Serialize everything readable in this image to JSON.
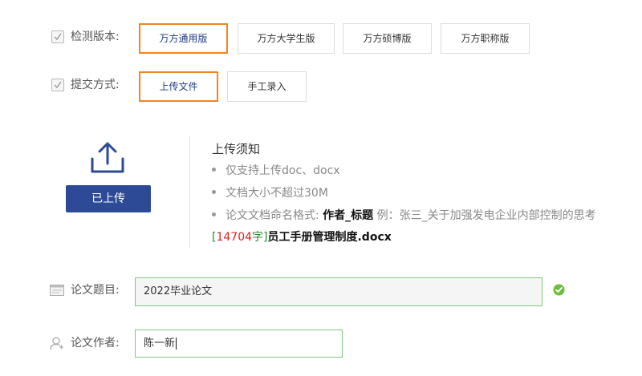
{
  "version_row": {
    "label": "检测版本:",
    "options": [
      "万方通用版",
      "万方大学生版",
      "万方硕博版",
      "万方职称版"
    ],
    "selected": "万方通用版"
  },
  "submit_row": {
    "label": "提交方式:",
    "options": [
      "上传文件",
      "手工录入"
    ],
    "selected": "上传文件"
  },
  "upload": {
    "icon": "upload-icon",
    "button_label": "已上传"
  },
  "notice": {
    "title": "上传须知",
    "items": [
      "仅支持上传doc、docx",
      "文档大小不超过30M"
    ],
    "naming_prefix": "论文文档命名格式:",
    "naming_format": "作者_标题",
    "naming_example": " 例：张三_关于加强发电企业内部控制的思考"
  },
  "uploaded_file": {
    "open_bracket": "[",
    "char_count": "14704",
    "unit": "字",
    "close_bracket": "]",
    "filename": "员工手册管理制度.docx"
  },
  "title_field": {
    "label": "论文题目:",
    "value": "2022毕业论文",
    "valid_icon": "check-circle-icon"
  },
  "author_field": {
    "label": "论文作者:",
    "value": "陈一新"
  },
  "colors": {
    "accent_orange": "#f5841f",
    "button_blue": "#2d4a96",
    "valid_green": "#7cc97c",
    "count_red": "#e02020"
  }
}
